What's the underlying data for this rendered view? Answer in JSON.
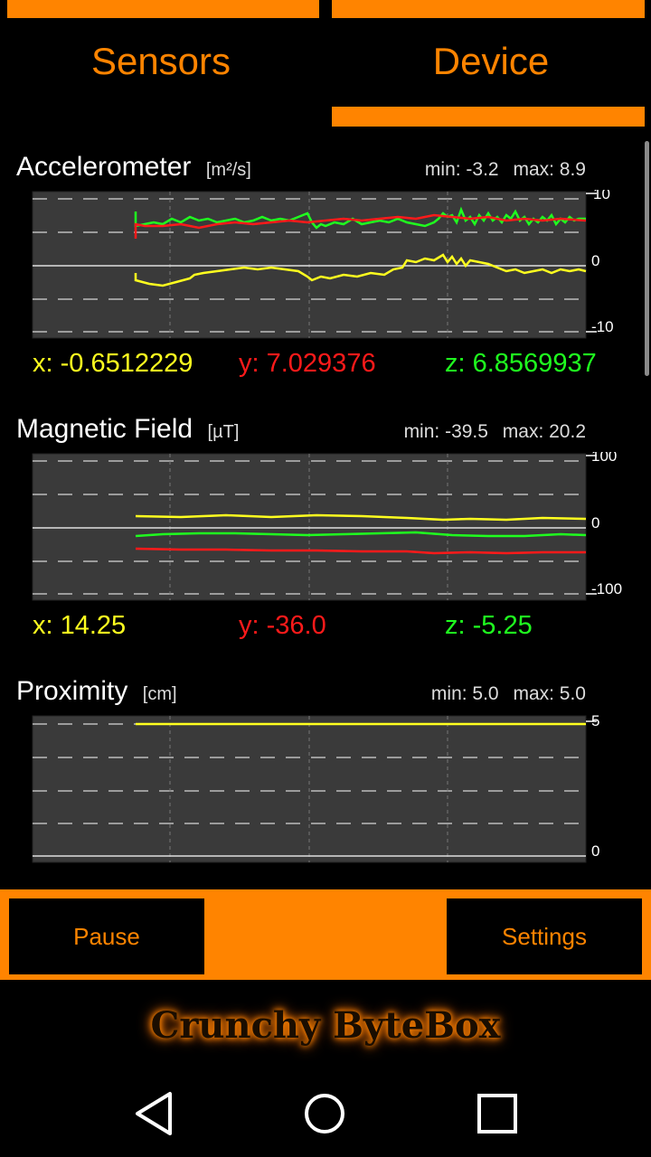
{
  "tabs": [
    {
      "label": "Sensors"
    },
    {
      "label": "Device"
    }
  ],
  "sensors": [
    {
      "name": "Accelerometer",
      "unit": "[m²/s]",
      "min_label": "min: -3.2",
      "max_label": "max: 8.9",
      "axis_labels": [
        "10",
        "0",
        "-10"
      ],
      "x_label": "x: -0.6512229",
      "y_label": "y: 7.029376",
      "z_label": "z: 6.8569937"
    },
    {
      "name": "Magnetic Field",
      "unit": "[µT]",
      "min_label": "min: -39.5",
      "max_label": "max: 20.2",
      "axis_labels": [
        "100",
        "0",
        "-100"
      ],
      "x_label": "x: 14.25",
      "y_label": "y: -36.0",
      "z_label": "z: -5.25"
    },
    {
      "name": "Proximity",
      "unit": "[cm]",
      "min_label": "min: 5.0",
      "max_label": "max: 5.0",
      "axis_labels": [
        "5",
        "0"
      ]
    }
  ],
  "controls": {
    "pause_label": "Pause",
    "settings_label": "Settings"
  },
  "brand": "Crunchy ByteBox",
  "colors": {
    "accent": "#ff8400",
    "x_series": "#ffff1f",
    "y_series": "#ff1a1a",
    "z_series": "#1fff1f",
    "plot_bg": "#3a3a3a"
  },
  "navbar": {
    "back": "back-triangle-icon",
    "home": "home-circle-icon",
    "recents": "recents-square-icon"
  }
}
